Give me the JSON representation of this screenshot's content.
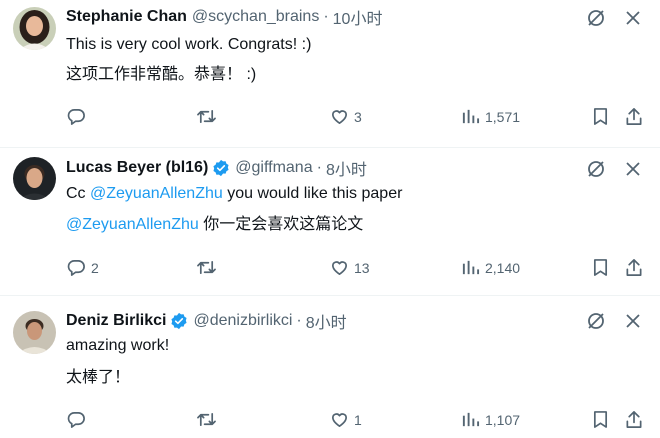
{
  "replies": [
    {
      "name": "Stephanie Chan",
      "handle": "@scychan_brains",
      "dot": "·",
      "time": "10小时",
      "lines": [
        "This is very cool work. Congrats! :)",
        "这项工作非常酷。恭喜！ :)"
      ],
      "verified": false,
      "reply_count": "",
      "retweet_count": "",
      "like_count": "3",
      "view_count": "1,571"
    },
    {
      "name": "Lucas Beyer (bl16)",
      "handle": "@giffmana",
      "dot": "·",
      "time": "8小时",
      "line1_prefix": "Cc ",
      "line1_mention": "@ZeyuanAllenZhu",
      "line1_suffix": " you would like this paper",
      "line2_mention": "@ZeyuanAllenZhu",
      "line2_suffix": " 你一定会喜欢这篇论文",
      "verified": true,
      "reply_count": "2",
      "retweet_count": "",
      "like_count": "13",
      "view_count": "2,140"
    },
    {
      "name": "Deniz Birlikci",
      "handle": "@denizbirlikci",
      "dot": "·",
      "time": "8小时",
      "lines": [
        "amazing work!",
        "太棒了！"
      ],
      "verified": true,
      "reply_count": "",
      "retweet_count": "",
      "like_count": "1",
      "view_count": "1,107"
    }
  ],
  "colors": {
    "text": "#0f1419",
    "secondary": "#536471",
    "link": "#1d9bf0",
    "verified": "#1d9bf0",
    "divider": "#eff3f4"
  },
  "icons": [
    "reply-icon",
    "retweet-icon",
    "like-icon",
    "views-icon",
    "bookmark-icon",
    "share-icon",
    "grok-icon",
    "more-icon",
    "verified-badge-icon"
  ]
}
